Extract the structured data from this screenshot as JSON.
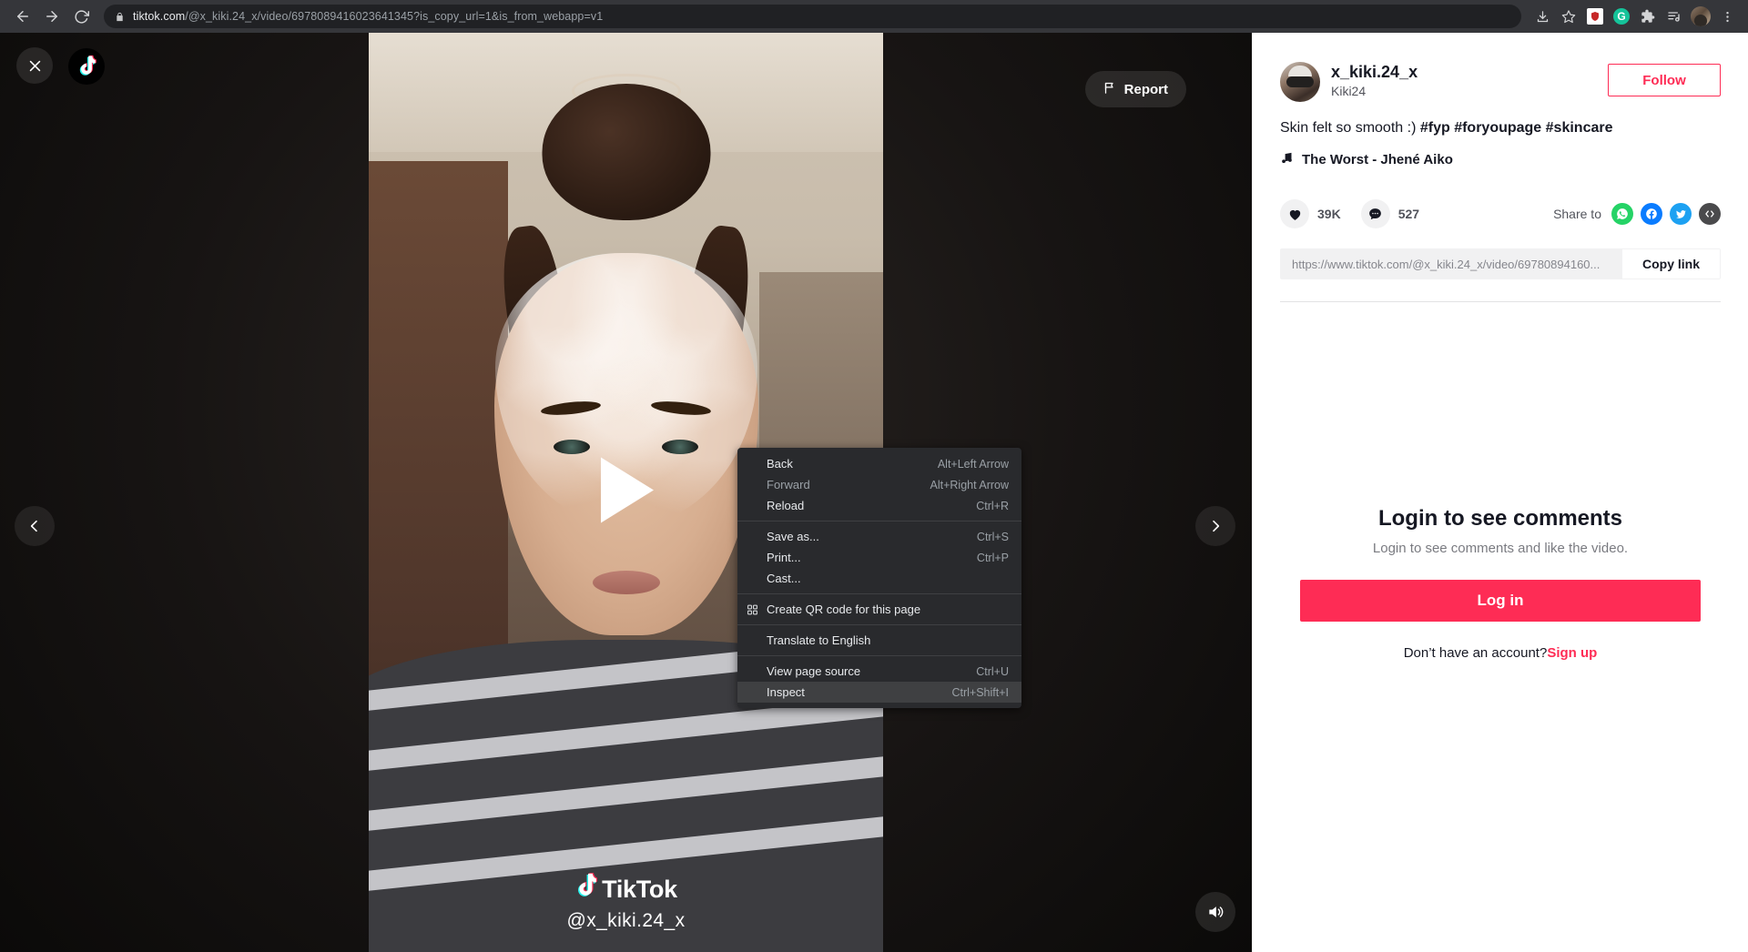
{
  "browser": {
    "back_label": "Back",
    "forward_label": "Forward",
    "reload_label": "Reload",
    "url_domain": "tiktok.com",
    "url_path": "/@x_kiki.24_x/video/6978089416023641345?is_copy_url=1&is_from_webapp=v1",
    "lock_icon": "lock-icon",
    "toolbar_icons": [
      {
        "name": "install-app-icon",
        "glyph": "download"
      },
      {
        "name": "bookmark-star-icon",
        "glyph": "star"
      },
      {
        "name": "extension-adblock-icon",
        "glyph": "shield"
      },
      {
        "name": "extension-grammarly-icon",
        "glyph": "G"
      },
      {
        "name": "extensions-puzzle-icon",
        "glyph": "puzzle"
      },
      {
        "name": "reading-list-icon",
        "glyph": "list"
      },
      {
        "name": "profile-avatar-icon",
        "glyph": "avatar"
      },
      {
        "name": "chrome-menu-icon",
        "glyph": "kebab"
      }
    ]
  },
  "context_menu": {
    "items": [
      {
        "label": "Back",
        "shortcut": "Alt+Left Arrow",
        "disabled": false,
        "selected": false,
        "icon": null
      },
      {
        "label": "Forward",
        "shortcut": "Alt+Right Arrow",
        "disabled": true,
        "selected": false,
        "icon": null
      },
      {
        "label": "Reload",
        "shortcut": "Ctrl+R",
        "disabled": false,
        "selected": false,
        "icon": null
      },
      {
        "separator": true
      },
      {
        "label": "Save as...",
        "shortcut": "Ctrl+S",
        "disabled": false,
        "selected": false,
        "icon": null
      },
      {
        "label": "Print...",
        "shortcut": "Ctrl+P",
        "disabled": false,
        "selected": false,
        "icon": null
      },
      {
        "label": "Cast...",
        "shortcut": "",
        "disabled": false,
        "selected": false,
        "icon": null
      },
      {
        "separator": true
      },
      {
        "label": "Create QR code for this page",
        "shortcut": "",
        "disabled": false,
        "selected": false,
        "icon": "qr-code-icon"
      },
      {
        "separator": true
      },
      {
        "label": "Translate to English",
        "shortcut": "",
        "disabled": false,
        "selected": false,
        "icon": null
      },
      {
        "separator": true
      },
      {
        "label": "View page source",
        "shortcut": "Ctrl+U",
        "disabled": false,
        "selected": false,
        "icon": null
      },
      {
        "label": "Inspect",
        "shortcut": "Ctrl+Shift+I",
        "disabled": false,
        "selected": true,
        "icon": null
      }
    ]
  },
  "stage": {
    "close_label": "",
    "report_label": "Report",
    "watermark_brand": "TikTok",
    "watermark_handle": "@x_kiki.24_x",
    "prev_label": "",
    "next_label": ""
  },
  "panel": {
    "author": {
      "username": "x_kiki.24_x",
      "nickname": "Kiki24"
    },
    "follow_label": "Follow",
    "caption_text": "Skin felt so smooth :) ",
    "caption_tags": "#fyp #foryoupage #skincare",
    "music_title": "The Worst - Jhené Aiko",
    "likes": "39K",
    "comments": "527",
    "share_label": "Share to",
    "share_targets": [
      "whatsapp-icon",
      "facebook-icon",
      "twitter-icon",
      "embed-icon"
    ],
    "link_url": "https://www.tiktok.com/@x_kiki.24_x/video/69780894160...",
    "copy_link_label": "Copy link",
    "login_title": "Login to see comments",
    "login_subtitle": "Login to see comments and like the video.",
    "login_button": "Log in",
    "signup_prompt": "Don’t have an account?",
    "signup_link": "Sign up"
  },
  "colors": {
    "tiktok_red": "#fe2c55",
    "chrome_toolbar": "#35363a",
    "omnibox": "#202124",
    "menu_bg": "#292a2d",
    "menu_selected": "#3f4042"
  }
}
